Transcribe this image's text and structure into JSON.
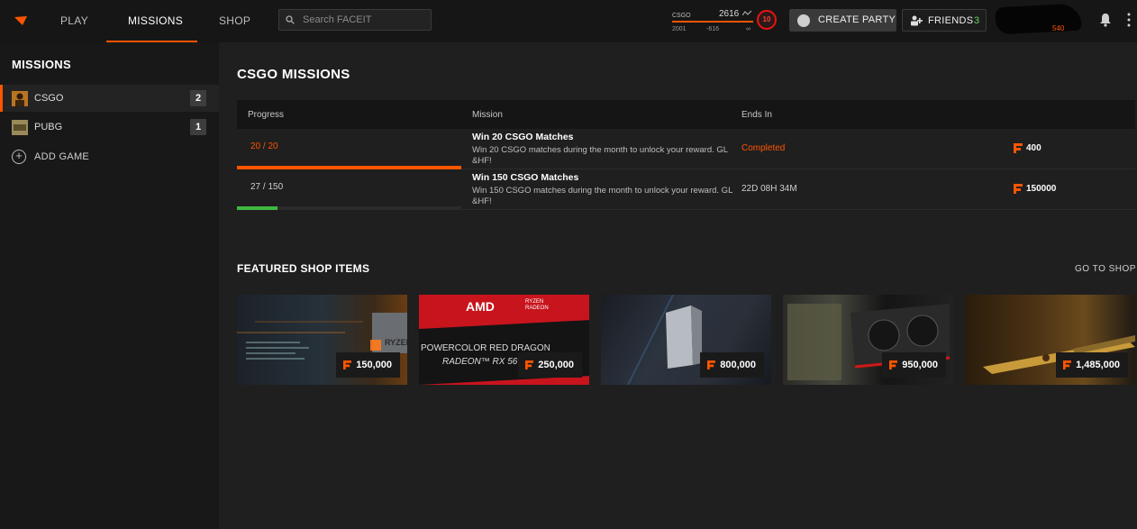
{
  "nav": {
    "items": [
      {
        "label": "PLAY"
      },
      {
        "label": "MISSIONS"
      },
      {
        "label": "SHOP"
      }
    ],
    "search_placeholder": "Search FACEIT"
  },
  "elo": {
    "game": "CSGO",
    "value": "2616",
    "min": "2001",
    "diff": "-616",
    "max": "∞",
    "level": "10"
  },
  "header": {
    "create_party_label": "CREATE PARTY",
    "friends_label": "FRIENDS",
    "friends_count": "3",
    "avatar_tag": "540"
  },
  "sidebar": {
    "title": "MISSIONS",
    "games": [
      {
        "label": "CSGO",
        "count": "2"
      },
      {
        "label": "PUBG",
        "count": "1"
      }
    ],
    "add_game_label": "ADD GAME"
  },
  "main": {
    "title": "CSGO MISSIONS",
    "columns": [
      "Progress",
      "Mission",
      "Ends In"
    ],
    "missions": [
      {
        "progress": "20 / 20",
        "progress_fraction": 1.0,
        "title": "Win 20 CSGO Matches",
        "description": "Win 20 CSGO matches during the month to unlock your reward. GL &HF!",
        "ends_in": "Completed",
        "reward": "400"
      },
      {
        "progress": "27 / 150",
        "progress_fraction": 0.18,
        "title": "Win 150 CSGO Matches",
        "description": "Win 150 CSGO matches during the month to unlock your reward. GL &HF!",
        "ends_in": "22D 08H 34M",
        "reward": "150000"
      }
    ]
  },
  "featured": {
    "title": "FEATURED SHOP ITEMS",
    "go_to_shop": "GO TO SHOP",
    "items": [
      {
        "price": "150,000",
        "art_text": "RYZEN"
      },
      {
        "price": "250,000",
        "brand": "AMD",
        "sub_brand": "RYZEN RADEON",
        "line1": "POWERCOLOR RED DRAGON",
        "line2": "RADEON™ RX 56"
      },
      {
        "price": "800,000"
      },
      {
        "price": "950,000"
      },
      {
        "price": "1,485,000"
      }
    ]
  },
  "colors": {
    "accent": "#ff5500",
    "success": "#5fd35f",
    "progress_partial": "#3fb93f"
  }
}
